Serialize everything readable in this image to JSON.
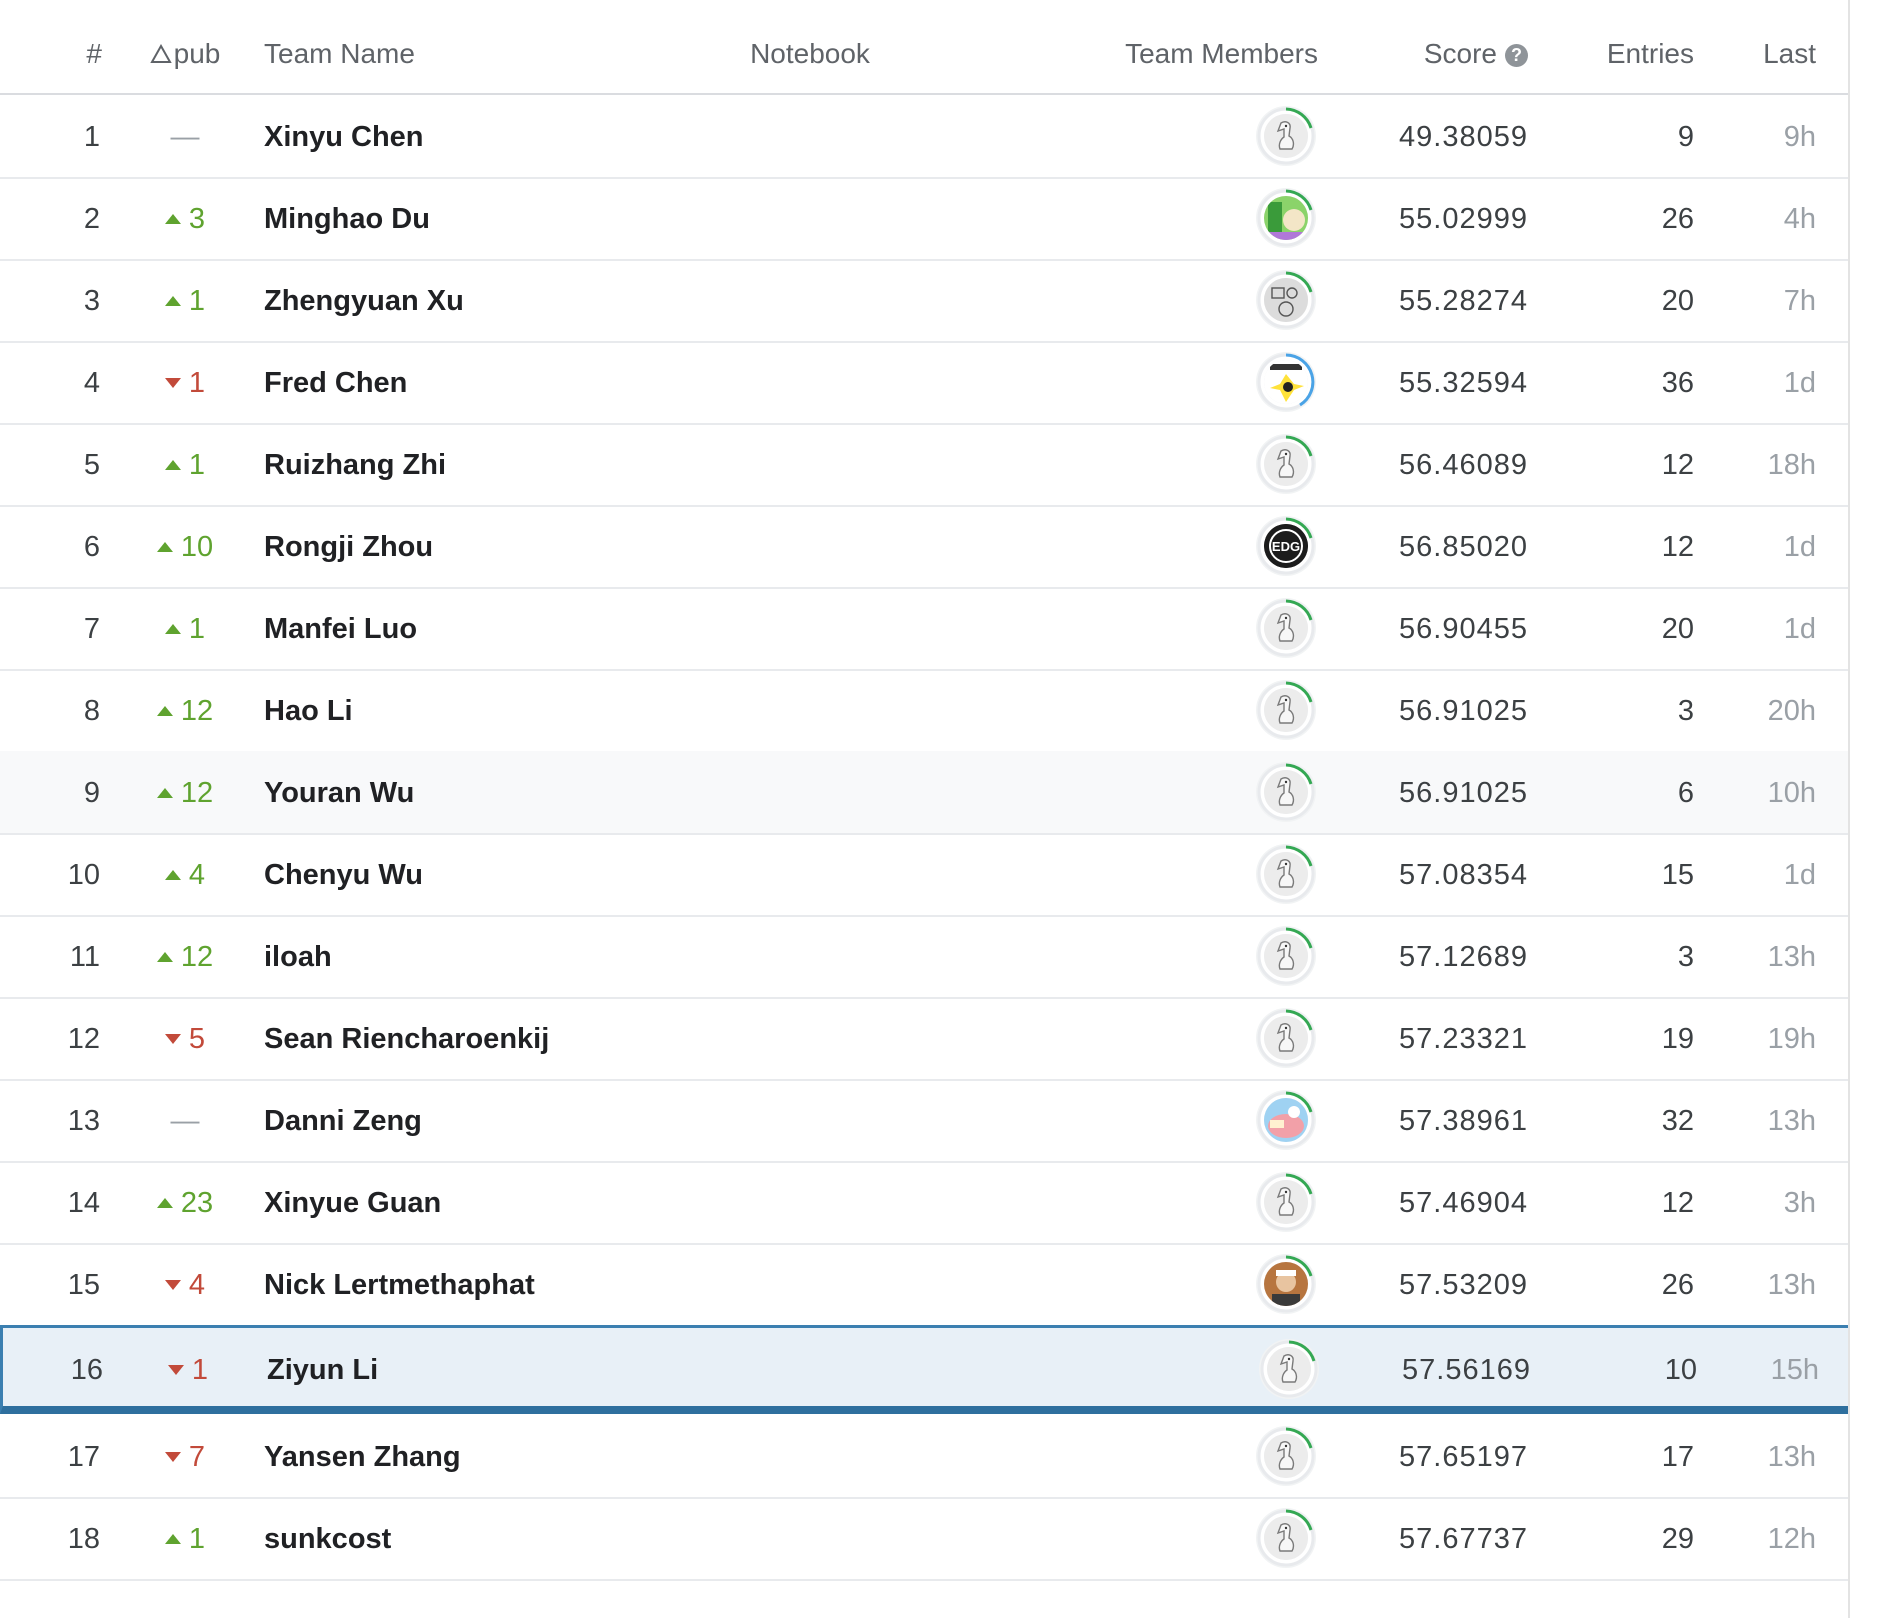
{
  "header": {
    "rank": "#",
    "delta": "pub",
    "team_name": "Team Name",
    "notebook": "Notebook",
    "team_members": "Team Members",
    "score": "Score",
    "entries": "Entries",
    "last": "Last"
  },
  "rows": [
    {
      "rank": "1",
      "dir": "same",
      "delta": "—",
      "name": "Xinyu Chen",
      "score": "49.38059",
      "entries": "9",
      "last": "9h",
      "avatar": "goose-icon",
      "ring": "#34a853"
    },
    {
      "rank": "2",
      "dir": "up",
      "delta": "3",
      "name": "Minghao Du",
      "score": "55.02999",
      "entries": "26",
      "last": "4h",
      "avatar": "photo-avatar",
      "ring": "#34a853"
    },
    {
      "rank": "3",
      "dir": "up",
      "delta": "1",
      "name": "Zhengyuan Xu",
      "score": "55.28274",
      "entries": "20",
      "last": "7h",
      "avatar": "sketch-avatar",
      "ring": "#34a853"
    },
    {
      "rank": "4",
      "dir": "down",
      "delta": "1",
      "name": "Fred Chen",
      "score": "55.32594",
      "entries": "36",
      "last": "1d",
      "avatar": "comic-avatar",
      "ring": "#4aa3e6"
    },
    {
      "rank": "5",
      "dir": "up",
      "delta": "1",
      "name": "Ruizhang Zhi",
      "score": "56.46089",
      "entries": "12",
      "last": "18h",
      "avatar": "goose-icon",
      "ring": "#34a853"
    },
    {
      "rank": "6",
      "dir": "up",
      "delta": "10",
      "name": "Rongji Zhou",
      "score": "56.85020",
      "entries": "12",
      "last": "1d",
      "avatar": "edg-logo",
      "ring": "#34a853"
    },
    {
      "rank": "7",
      "dir": "up",
      "delta": "1",
      "name": "Manfei Luo",
      "score": "56.90455",
      "entries": "20",
      "last": "1d",
      "avatar": "goose-icon",
      "ring": "#34a853"
    },
    {
      "rank": "8",
      "dir": "up",
      "delta": "12",
      "name": "Hao Li",
      "score": "56.91025",
      "entries": "3",
      "last": "20h",
      "avatar": "goose-icon",
      "ring": "#34a853"
    },
    {
      "rank": "9",
      "dir": "up",
      "delta": "12",
      "name": "Youran Wu",
      "score": "56.91025",
      "entries": "6",
      "last": "10h",
      "avatar": "goose-icon",
      "ring": "#34a853"
    },
    {
      "rank": "10",
      "dir": "up",
      "delta": "4",
      "name": "Chenyu Wu",
      "score": "57.08354",
      "entries": "15",
      "last": "1d",
      "avatar": "goose-icon",
      "ring": "#34a853"
    },
    {
      "rank": "11",
      "dir": "up",
      "delta": "12",
      "name": "iloah",
      "score": "57.12689",
      "entries": "3",
      "last": "13h",
      "avatar": "goose-icon",
      "ring": "#34a853"
    },
    {
      "rank": "12",
      "dir": "down",
      "delta": "5",
      "name": "Sean Riencharoenkij",
      "score": "57.23321",
      "entries": "19",
      "last": "19h",
      "avatar": "goose-icon",
      "ring": "#34a853"
    },
    {
      "rank": "13",
      "dir": "same",
      "delta": "—",
      "name": "Danni Zeng",
      "score": "57.38961",
      "entries": "32",
      "last": "13h",
      "avatar": "anime-avatar",
      "ring": "#34a853"
    },
    {
      "rank": "14",
      "dir": "up",
      "delta": "23",
      "name": "Xinyue Guan",
      "score": "57.46904",
      "entries": "12",
      "last": "3h",
      "avatar": "goose-icon",
      "ring": "#34a853"
    },
    {
      "rank": "15",
      "dir": "down",
      "delta": "4",
      "name": "Nick Lertmethaphat",
      "score": "57.53209",
      "entries": "26",
      "last": "13h",
      "avatar": "person-photo",
      "ring": "#34a853"
    },
    {
      "rank": "16",
      "dir": "down",
      "delta": "1",
      "name": "Ziyun Li",
      "score": "57.56169",
      "entries": "10",
      "last": "15h",
      "avatar": "goose-icon",
      "ring": "#34a853"
    },
    {
      "rank": "17",
      "dir": "down",
      "delta": "7",
      "name": "Yansen Zhang",
      "score": "57.65197",
      "entries": "17",
      "last": "13h",
      "avatar": "goose-icon",
      "ring": "#34a853"
    },
    {
      "rank": "18",
      "dir": "up",
      "delta": "1",
      "name": "sunkcost",
      "score": "57.67737",
      "entries": "29",
      "last": "12h",
      "avatar": "goose-icon",
      "ring": "#34a853"
    }
  ],
  "colors": {
    "up": "#5fa32f",
    "down": "#c24a3a",
    "highlight_border": "#3b7fb0",
    "highlight_bg": "#e8f0f7"
  }
}
